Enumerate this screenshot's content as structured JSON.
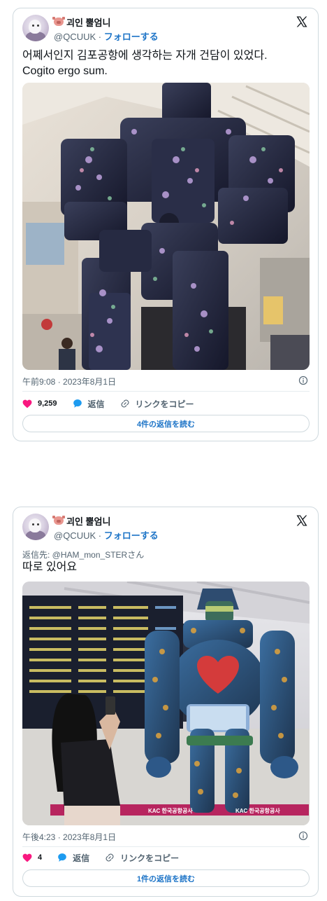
{
  "tweets": [
    {
      "display_name": "괴인 뿔엄니",
      "handle": "@QCUUK",
      "separator": "·",
      "follow_label": "フォローする",
      "reply_to": "",
      "text_lines": [
        "어쩨서인지 김포공항에 생각하는 자개 건담이 있었다.",
        "Cogito ergo sum."
      ],
      "time": "午前9:08 · 2023年8月1日",
      "likes": "9,259",
      "reply_label": "返信",
      "copy_link_label": "リンクをコピー",
      "read_replies_label": "4件の返信を読む"
    },
    {
      "display_name": "괴인 뿔엄니",
      "handle": "@QCUUK",
      "separator": "·",
      "follow_label": "フォローする",
      "reply_to": "返信先: @HAM_mon_STERさん",
      "text_lines": [
        "따로 있어요"
      ],
      "time": "午後4:23 · 2023年8月1日",
      "likes": "4",
      "reply_label": "返信",
      "copy_link_label": "リンクをコピー",
      "read_replies_label": "1件の返信を読む",
      "photo_signs": [
        "KAC 한국공항공사",
        "KAC 한국공항공사"
      ]
    }
  ],
  "colors": {
    "like": "#f91880",
    "reply": "#1d9bf0",
    "link": "#1d74c7",
    "muted": "#536471",
    "border": "#cfd9de"
  }
}
